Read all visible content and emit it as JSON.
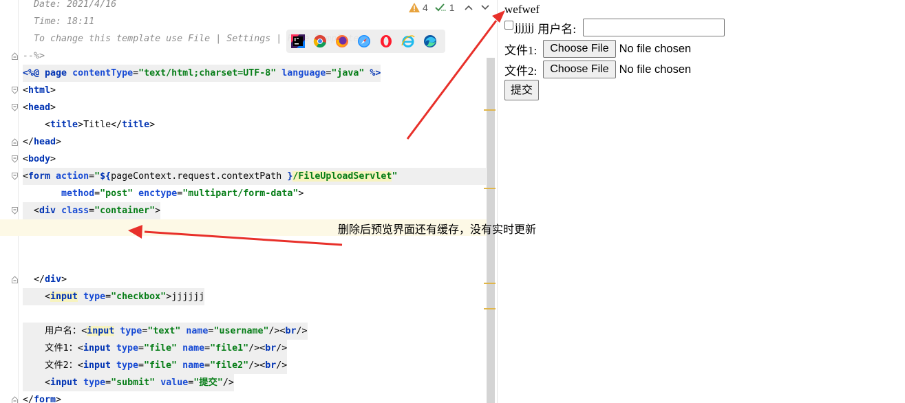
{
  "editor": {
    "lines": [
      {
        "top": 0,
        "fold": "",
        "tokens": [
          {
            "c": "tk-cmt",
            "t": "  Date: 2021/4/16"
          }
        ]
      },
      {
        "top": 0,
        "fold": "",
        "tokens": [
          {
            "c": "tk-cmt",
            "t": "  Time: 18:11"
          }
        ]
      },
      {
        "top": 0,
        "fold": "",
        "tokens": [
          {
            "c": "tk-cmt",
            "t": "  To change this template use File | Settings | File Templates."
          }
        ]
      },
      {
        "top": 0,
        "fold": "end",
        "tokens": [
          {
            "c": "tk-cmt",
            "t": "--%>"
          }
        ]
      },
      {
        "top": 0,
        "fold": "",
        "hl": true,
        "tokens": [
          {
            "c": "tk-dir",
            "t": "<%@ "
          },
          {
            "c": "tk-dir",
            "t": "page "
          },
          {
            "c": "tk-attr",
            "t": "contentType"
          },
          {
            "c": "tk-br",
            "t": "="
          },
          {
            "c": "tk-val",
            "t": "\"text/html;charset=UTF-8\""
          },
          {
            "c": "tk-br",
            "t": " "
          },
          {
            "c": "tk-attr",
            "t": "language"
          },
          {
            "c": "tk-br",
            "t": "="
          },
          {
            "c": "tk-val",
            "t": "\"java\""
          },
          {
            "c": "tk-br",
            "t": " "
          },
          {
            "c": "tk-dir",
            "t": "%>"
          }
        ]
      },
      {
        "top": 0,
        "fold": "start",
        "tokens": [
          {
            "c": "tk-br",
            "t": "<"
          },
          {
            "c": "tk-tag",
            "t": "html"
          },
          {
            "c": "tk-br",
            "t": ">"
          }
        ]
      },
      {
        "top": 0,
        "fold": "start",
        "tokens": [
          {
            "c": "tk-br",
            "t": "<"
          },
          {
            "c": "tk-tag",
            "t": "head"
          },
          {
            "c": "tk-br",
            "t": ">"
          }
        ]
      },
      {
        "top": 0,
        "fold": "",
        "tokens": [
          {
            "c": "tk-br",
            "t": "    <"
          },
          {
            "c": "tk-tag",
            "t": "title"
          },
          {
            "c": "tk-br",
            "t": ">"
          },
          {
            "c": "tk-text",
            "t": "Title"
          },
          {
            "c": "tk-br",
            "t": "</"
          },
          {
            "c": "tk-tag",
            "t": "title"
          },
          {
            "c": "tk-br",
            "t": ">"
          }
        ]
      },
      {
        "top": 0,
        "fold": "end",
        "tokens": [
          {
            "c": "tk-br",
            "t": "</"
          },
          {
            "c": "tk-tag",
            "t": "head"
          },
          {
            "c": "tk-br",
            "t": ">"
          }
        ]
      },
      {
        "top": 0,
        "fold": "start",
        "tokens": [
          {
            "c": "tk-br",
            "t": "<"
          },
          {
            "c": "tk-tag",
            "t": "body"
          },
          {
            "c": "tk-br",
            "t": ">"
          }
        ]
      },
      {
        "top": 0,
        "fold": "start",
        "hl": true,
        "wide": true,
        "tokens": [
          {
            "c": "tk-br",
            "t": "<"
          },
          {
            "c": "tk-tag",
            "t": "form "
          },
          {
            "c": "tk-attr",
            "t": "action"
          },
          {
            "c": "tk-br",
            "t": "="
          },
          {
            "c": "tk-val",
            "t": "\""
          },
          {
            "c": "tk-dir",
            "t": "${"
          },
          {
            "c": "tk-text",
            "t": "pageContext.request.contextPath "
          },
          {
            "c": "tk-dir",
            "t": "}"
          },
          {
            "c": "tk-hl-val",
            "t": "/FileUploadServlet"
          },
          {
            "c": "tk-val",
            "t": "\""
          }
        ]
      },
      {
        "top": 0,
        "fold": "",
        "tokens": [
          {
            "c": "tk-br",
            "t": "       "
          },
          {
            "c": "tk-attr",
            "t": "method"
          },
          {
            "c": "tk-br",
            "t": "="
          },
          {
            "c": "tk-val",
            "t": "\"post\""
          },
          {
            "c": "tk-br",
            "t": " "
          },
          {
            "c": "tk-attr",
            "t": "enctype"
          },
          {
            "c": "tk-br",
            "t": "="
          },
          {
            "c": "tk-val",
            "t": "\"multipart/form-data\""
          },
          {
            "c": "tk-br",
            "t": ">"
          }
        ]
      },
      {
        "top": 0,
        "fold": "start",
        "hl": true,
        "tokens": [
          {
            "c": "tk-br",
            "t": "  <"
          },
          {
            "c": "tk-tag",
            "t": "div "
          },
          {
            "c": "tk-attr",
            "t": "class"
          },
          {
            "c": "tk-br",
            "t": "="
          },
          {
            "c": "tk-val",
            "t": "\"container\""
          },
          {
            "c": "tk-br",
            "t": ">"
          }
        ]
      },
      {
        "top": 0,
        "fold": "",
        "tokens": [
          {
            "c": "tk-text",
            "t": ""
          }
        ]
      },
      {
        "top": 0,
        "fold": "",
        "tokens": [
          {
            "c": "tk-text",
            "t": ""
          }
        ]
      },
      {
        "top": 0,
        "fold": "",
        "tokens": [
          {
            "c": "tk-text",
            "t": ""
          }
        ]
      },
      {
        "top": 0,
        "fold": "end",
        "tokens": [
          {
            "c": "tk-br",
            "t": "  </"
          },
          {
            "c": "tk-tag",
            "t": "div"
          },
          {
            "c": "tk-br",
            "t": ">"
          }
        ]
      },
      {
        "top": 0,
        "fold": "",
        "hl": true,
        "tokens": [
          {
            "c": "tk-br",
            "t": "    <"
          },
          {
            "c": "tk-tag-y",
            "t": "input"
          },
          {
            "c": "tk-br",
            "t": " "
          },
          {
            "c": "tk-attr",
            "t": "type"
          },
          {
            "c": "tk-br",
            "t": "="
          },
          {
            "c": "tk-val",
            "t": "\"checkbox\""
          },
          {
            "c": "tk-br",
            "t": ">"
          },
          {
            "c": "tk-text",
            "t": "jjjjjj"
          }
        ]
      },
      {
        "top": 0,
        "fold": "",
        "tokens": [
          {
            "c": "tk-text",
            "t": ""
          }
        ]
      },
      {
        "top": 0,
        "fold": "",
        "hl": true,
        "tokens": [
          {
            "c": "tk-text",
            "t": "    用户名："
          },
          {
            "c": "tk-br",
            "t": "<"
          },
          {
            "c": "tk-tag-y",
            "t": "input"
          },
          {
            "c": "tk-br",
            "t": " "
          },
          {
            "c": "tk-attr",
            "t": "type"
          },
          {
            "c": "tk-br",
            "t": "="
          },
          {
            "c": "tk-val",
            "t": "\"text\""
          },
          {
            "c": "tk-br",
            "t": " "
          },
          {
            "c": "tk-attr",
            "t": "name"
          },
          {
            "c": "tk-br",
            "t": "="
          },
          {
            "c": "tk-val",
            "t": "\"username\""
          },
          {
            "c": "tk-br",
            "t": "/><"
          },
          {
            "c": "tk-tag",
            "t": "br"
          },
          {
            "c": "tk-br",
            "t": "/>"
          }
        ]
      },
      {
        "top": 0,
        "fold": "",
        "hl": true,
        "tokens": [
          {
            "c": "tk-text",
            "t": "    文件1："
          },
          {
            "c": "tk-br",
            "t": "<"
          },
          {
            "c": "tk-tag",
            "t": "input"
          },
          {
            "c": "tk-br",
            "t": " "
          },
          {
            "c": "tk-attr",
            "t": "type"
          },
          {
            "c": "tk-br",
            "t": "="
          },
          {
            "c": "tk-val",
            "t": "\"file\""
          },
          {
            "c": "tk-br",
            "t": " "
          },
          {
            "c": "tk-attr",
            "t": "name"
          },
          {
            "c": "tk-br",
            "t": "="
          },
          {
            "c": "tk-val",
            "t": "\"file1\""
          },
          {
            "c": "tk-br",
            "t": "/><"
          },
          {
            "c": "tk-tag",
            "t": "br"
          },
          {
            "c": "tk-br",
            "t": "/>"
          }
        ]
      },
      {
        "top": 0,
        "fold": "",
        "hl": true,
        "tokens": [
          {
            "c": "tk-text",
            "t": "    文件2："
          },
          {
            "c": "tk-br",
            "t": "<"
          },
          {
            "c": "tk-tag",
            "t": "input"
          },
          {
            "c": "tk-br",
            "t": " "
          },
          {
            "c": "tk-attr",
            "t": "type"
          },
          {
            "c": "tk-br",
            "t": "="
          },
          {
            "c": "tk-val",
            "t": "\"file\""
          },
          {
            "c": "tk-br",
            "t": " "
          },
          {
            "c": "tk-attr",
            "t": "name"
          },
          {
            "c": "tk-br",
            "t": "="
          },
          {
            "c": "tk-val",
            "t": "\"file2\""
          },
          {
            "c": "tk-br",
            "t": "/><"
          },
          {
            "c": "tk-tag",
            "t": "br"
          },
          {
            "c": "tk-br",
            "t": "/>"
          }
        ]
      },
      {
        "top": 0,
        "fold": "",
        "hl": true,
        "tokens": [
          {
            "c": "tk-br",
            "t": "    <"
          },
          {
            "c": "tk-tag",
            "t": "input"
          },
          {
            "c": "tk-br",
            "t": " "
          },
          {
            "c": "tk-attr",
            "t": "type"
          },
          {
            "c": "tk-br",
            "t": "="
          },
          {
            "c": "tk-val",
            "t": "\"submit\""
          },
          {
            "c": "tk-br",
            "t": " "
          },
          {
            "c": "tk-attr",
            "t": "value"
          },
          {
            "c": "tk-br",
            "t": "="
          },
          {
            "c": "tk-val",
            "t": "\"提交\""
          },
          {
            "c": "tk-br",
            "t": "/>"
          }
        ]
      },
      {
        "top": 0,
        "fold": "end",
        "tokens": [
          {
            "c": "tk-br",
            "t": "</"
          },
          {
            "c": "tk-tag",
            "t": "form"
          },
          {
            "c": "tk-br",
            "t": ">"
          }
        ]
      }
    ],
    "inspection": {
      "warnings": "4",
      "typos": "1"
    }
  },
  "preview": {
    "heading": "wefwef",
    "checkbox_label": "jjjjjj",
    "username_label": "用户名:",
    "file1_label": "文件1:",
    "file2_label": "文件2:",
    "choose_file": "Choose File",
    "no_file": "No file chosen",
    "submit_label": "提交"
  },
  "annotation": {
    "text": "删除后预览界面还有缓存，没有实时更新",
    "color": "#e8302a"
  },
  "colors": {
    "accent_warning": "#e0b64a",
    "current_line": "#fdf9e6"
  }
}
